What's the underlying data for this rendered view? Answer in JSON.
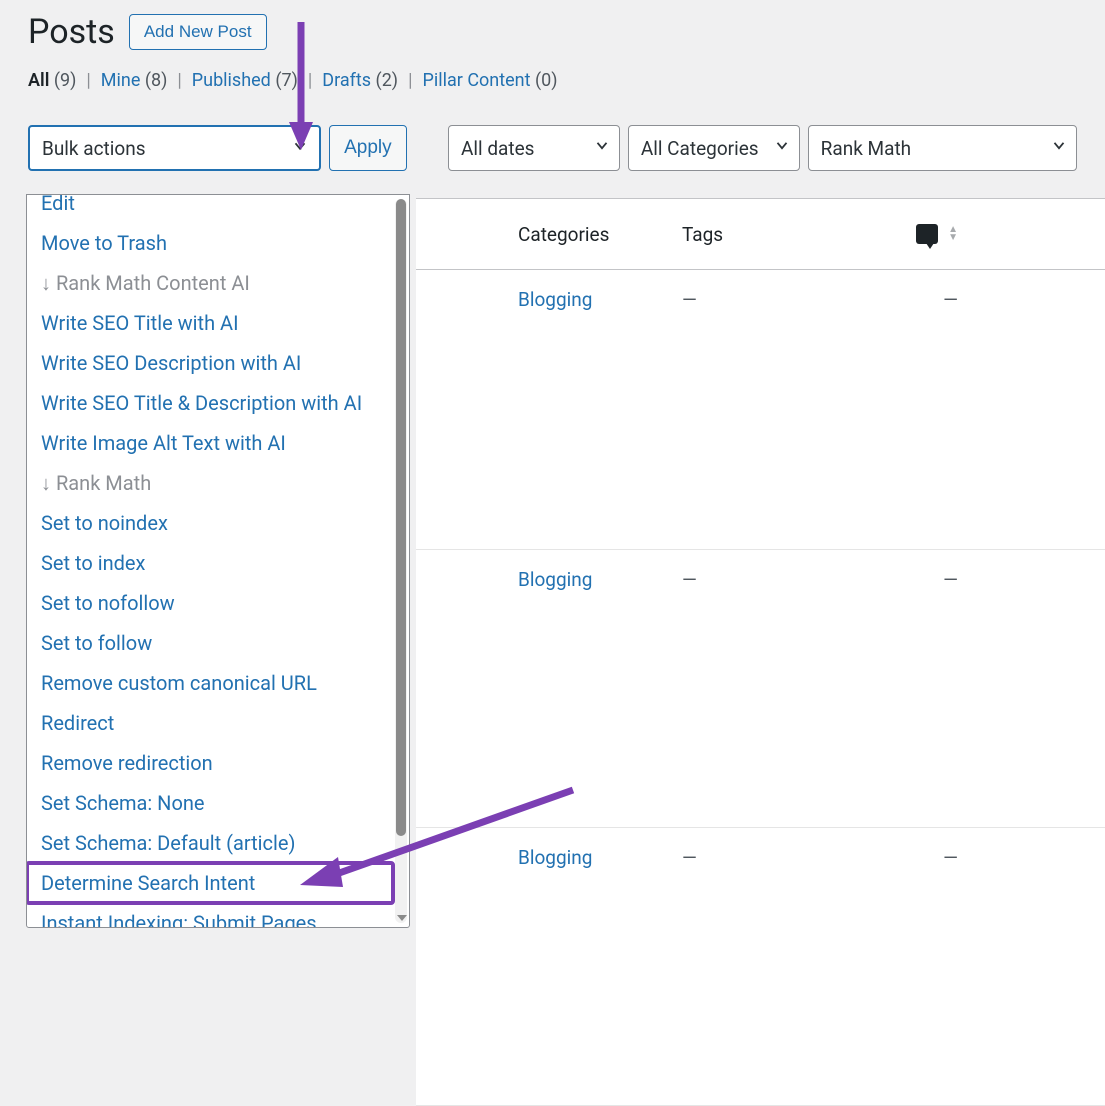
{
  "header": {
    "title": "Posts",
    "add_new_label": "Add New Post"
  },
  "filters": {
    "all": {
      "label": "All",
      "count": "(9)"
    },
    "mine": {
      "label": "Mine",
      "count": "(8)"
    },
    "published": {
      "label": "Published",
      "count": "(7)"
    },
    "drafts": {
      "label": "Drafts",
      "count": "(2)"
    },
    "pillar": {
      "label": "Pillar Content",
      "count": "(0)"
    }
  },
  "bulk": {
    "selected": "Bulk actions",
    "apply_label": "Apply",
    "options": {
      "edit": "Edit",
      "trash": "Move to Trash",
      "grp_content_ai": "↓ Rank Math Content AI",
      "seo_title": "Write SEO Title with AI",
      "seo_desc": "Write SEO Description with AI",
      "seo_title_desc": "Write SEO Title & Description with AI",
      "alt_text": "Write Image Alt Text with AI",
      "grp_rank_math": "↓ Rank Math",
      "noindex": "Set to noindex",
      "index": "Set to index",
      "nofollow": "Set to nofollow",
      "follow": "Set to follow",
      "remove_canon": "Remove custom canonical URL",
      "redirect": "Redirect",
      "remove_redir": "Remove redirection",
      "schema_none": "Set Schema: None",
      "schema_default": "Set Schema: Default (article)",
      "determine": "Determine Search Intent",
      "instant_index": "Instant Indexing: Submit Pages"
    }
  },
  "top_selects": {
    "dates": "All dates",
    "cats": "All Categories",
    "rank": "Rank Math"
  },
  "table": {
    "columns": {
      "categories": "Categories",
      "tags": "Tags"
    },
    "rows": [
      {
        "category": "Blogging",
        "tags": "—",
        "comments": "—"
      },
      {
        "category": "Blogging",
        "tags": "—",
        "comments": "—"
      },
      {
        "category": "Blogging",
        "tags": "—",
        "comments": "—"
      }
    ]
  }
}
